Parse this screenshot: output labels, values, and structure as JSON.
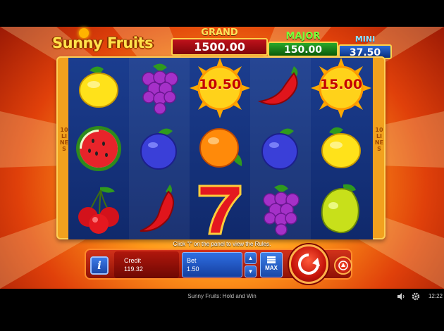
{
  "game": {
    "title": "Sunny Fruits: Hold and Win",
    "logo_text": "Sunny Fruits"
  },
  "jackpots": {
    "grand": {
      "label": "GRAND",
      "value": "1500.00"
    },
    "major": {
      "label": "MAJOR",
      "value": "150.00"
    },
    "mini": {
      "label": "MINI",
      "value": "37.50"
    }
  },
  "lines_side": {
    "left": "10 LINES",
    "right": "10 LINES"
  },
  "reels": [
    [
      "lemon",
      "watermelon",
      "cherries"
    ],
    [
      "grapes",
      "plum",
      "chili-pepper"
    ],
    [
      "sun-bonus",
      "orange",
      "seven"
    ],
    [
      "chili-pepper",
      "plum",
      "grapes"
    ],
    [
      "sun-bonus",
      "lemon",
      "pear"
    ]
  ],
  "sun_values": {
    "reel3": "10.50",
    "reel5": "15.00"
  },
  "info_text": "Click \"i\" on the panel to view the Rules.",
  "panel": {
    "info_button_label": "i",
    "credit_label": "Credit",
    "credit_value": "119.32",
    "bet_label": "Bet",
    "bet_value": "1.50",
    "bet_up_icon": "triangle-up-icon",
    "bet_down_icon": "triangle-down-icon",
    "max_label": "MAX",
    "spin_icon": "spin-arrow-icon",
    "autoplay_icon": "autoplay-icon"
  },
  "status_bar": {
    "time": "12:22",
    "sound_icon": "speaker-icon",
    "settings_icon": "gear-icon"
  },
  "colors": {
    "grand_red": "#c0121b",
    "major_green": "#2aa82a",
    "mini_blue": "#2a6ad6",
    "reel_blue": "#1b3d8f",
    "frame_orange": "#f2a11e"
  }
}
